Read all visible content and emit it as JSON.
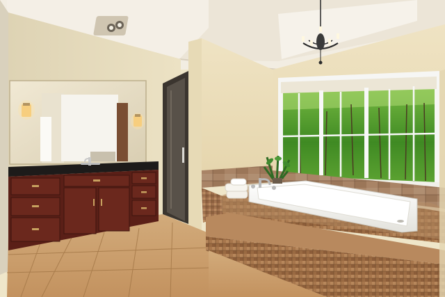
{
  "scene": {
    "kind": "photo",
    "subject": "bathroom",
    "palette": {
      "wall": "#ece0bd",
      "ceiling": "#f2ede2",
      "cabinet": "#5a1f17",
      "countertop": "#1d1b1a",
      "floor_tile": "#c79a68",
      "mosaic_tile": "#9a6b45",
      "tub": "#f4f3ef",
      "window_frame": "#f8f8f8",
      "greenery": "#3f8a23"
    }
  }
}
